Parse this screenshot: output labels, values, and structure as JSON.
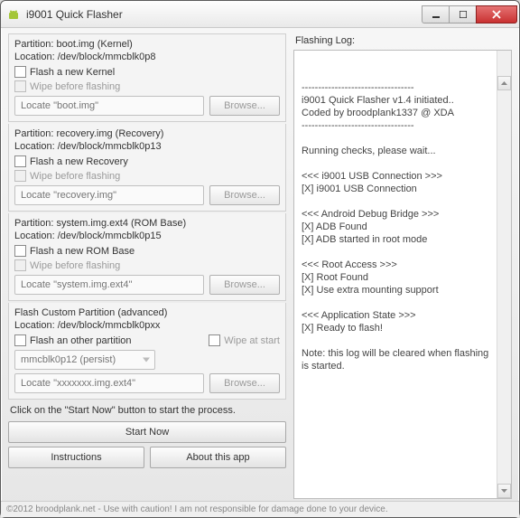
{
  "window": {
    "title": "i9001 Quick Flasher"
  },
  "sections": {
    "kernel": {
      "partition_line": "Partition: boot.img (Kernel)",
      "location_line": "Location: /dev/block/mmcblk0p8",
      "flash_label": "Flash a new Kernel",
      "wipe_label": "Wipe before flashing",
      "placeholder": "Locate \"boot.img\"",
      "browse": "Browse..."
    },
    "recovery": {
      "partition_line": "Partition: recovery.img (Recovery)",
      "location_line": "Location: /dev/block/mmcblk0p13",
      "flash_label": "Flash a new Recovery",
      "wipe_label": "Wipe before flashing",
      "placeholder": "Locate \"recovery.img\"",
      "browse": "Browse..."
    },
    "system": {
      "partition_line": "Partition: system.img.ext4 (ROM Base)",
      "location_line": "Location: /dev/block/mmcblk0p15",
      "flash_label": "Flash a new ROM Base",
      "wipe_label": "Wipe before flashing",
      "placeholder": "Locate \"system.img.ext4\"",
      "browse": "Browse..."
    },
    "custom": {
      "partition_line": "Flash Custom Partition (advanced)",
      "location_line": "Location: /dev/block/mmcblk0pxx",
      "flash_label": "Flash an other partition",
      "wipe_label": "Wipe at start",
      "dd_value": "mmcblk0p12 (persist)",
      "placeholder": "Locate \"xxxxxxx.img.ext4\"",
      "browse": "Browse..."
    }
  },
  "start_note": "Click on the \"Start Now\" button to start the process.",
  "buttons": {
    "start": "Start Now",
    "instructions": "Instructions",
    "about": "About this app"
  },
  "log": {
    "header": "Flashing Log:",
    "lines": [
      "----------------------------------",
      "i9001 Quick Flasher v1.4 initiated..",
      "Coded by broodplank1337 @ XDA",
      "----------------------------------",
      "",
      "Running checks, please wait...",
      "",
      "<<< i9001 USB Connection >>>",
      "[X] i9001 USB Connection",
      "",
      "<<< Android Debug Bridge >>>",
      "[X] ADB Found",
      "[X] ADB started in root mode",
      "",
      "<<< Root Access >>>",
      "[X] Root Found",
      "[X] Use extra mounting support",
      "",
      "<<< Application State >>>",
      "[X] Ready to flash!",
      "",
      "Note: this log will be cleared when flashing is started."
    ]
  },
  "footer": "©2012 broodplank.net - Use with caution! I am not responsible for damage done to your device."
}
